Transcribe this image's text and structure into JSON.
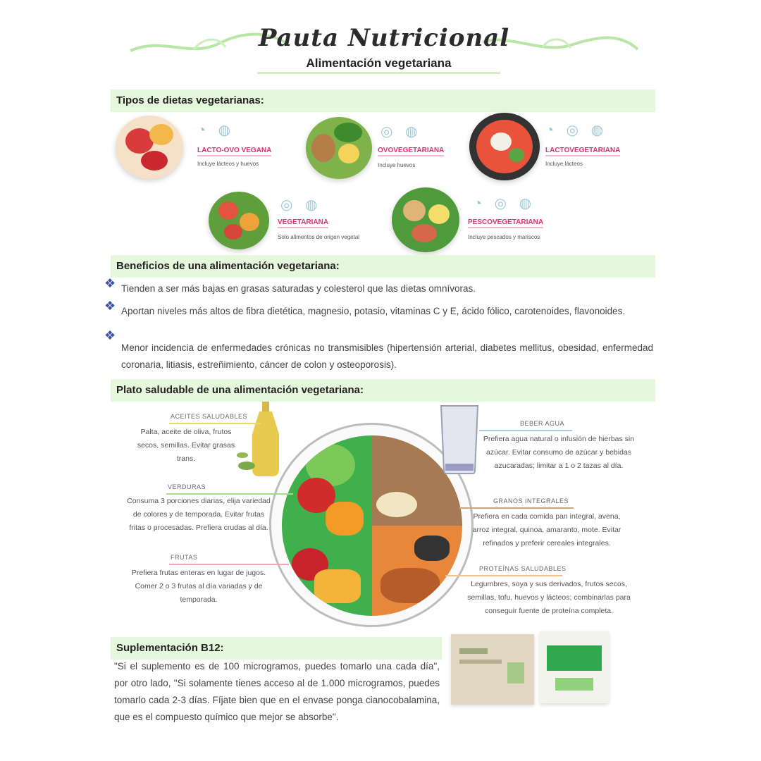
{
  "header": {
    "title": "Pauta Nutricional",
    "subtitle": "Alimentación vegetariana"
  },
  "sections": {
    "types": "Tipos de dietas vegetarianas:",
    "benefits": "Beneficios de una alimentación vegetariana:",
    "plate": "Plato saludable de una alimentación vegetariana:",
    "supplement": "Suplementación B12:"
  },
  "diets": [
    {
      "name": "LACTO-OVO VEGANA",
      "desc": "Incluye lácteos y huevos"
    },
    {
      "name": "OVOVEGETARIANA",
      "desc": "Incluye huevos"
    },
    {
      "name": "LACTOVEGETARIANA",
      "desc": "Incluye lácteos"
    },
    {
      "name": "VEGETARIANA",
      "desc": "Solo alimentos de origen vegetal"
    },
    {
      "name": "PESCOVEGETARIANA",
      "desc": "Incluye pescados y mariscos"
    }
  ],
  "benefits": [
    "Tienden a ser más bajas en grasas saturadas y colesterol que las dietas omnívoras.",
    "Aportan niveles más altos de fibra dietética, magnesio, potasio, vitaminas C y E, ácido fólico, carotenoides, flavonoides.",
    "Menor incidencia de enfermedades crónicas no transmisibles (hipertensión arterial, diabetes mellitus, obesidad, enfermedad coronaria, litiasis, estreñimiento, cáncer de colon y osteoporosis)."
  ],
  "plate": {
    "oils": {
      "label": "ACEITES SALUDABLES",
      "text": "Palta, aceite de oliva, frutos secos, semillas. Evitar grasas trans."
    },
    "water": {
      "label": "BEBER AGUA",
      "text": "Prefiera agua natural o infusión de hierbas sin azúcar. Evitar consumo de azúcar y bebidas azucaradas; limitar a 1 o 2 tazas al día."
    },
    "vegetables": {
      "label": "VERDURAS",
      "text": "Consuma 3 porciones diarias, elija variedad de colores y de temporada. Evitar frutas fritas o procesadas. Prefiera crudas al día."
    },
    "grains": {
      "label": "GRANOS INTEGRALES",
      "text": "Prefiera en cada comida pan integral, avena, arroz integral, quinoa, amaranto, mote. Evitar refinados y preferir cereales integrales."
    },
    "fruits": {
      "label": "FRUTAS",
      "text": "Prefiera frutas enteras en lugar de jugos. Comer 2 o 3 frutas al día variadas y de temporada."
    },
    "proteins": {
      "label": "PROTEÍNAS SALUDABLES",
      "text": "Legumbres, soya y sus derivados, frutos secos, semillas, tofu, huevos y lácteos; combinarlas para conseguir fuente de proteína completa."
    }
  },
  "supplement": {
    "text": "\"Si el suplemento es de 100 microgramos, puedes tomarlo una cada día\", por otro lado, \"Si solamente tienes acceso al de 1.000 microgramos, puedes tomarlo cada 2-3 días. Fíjate bien que en el envase ponga cianocobalamina, que es el compuesto químico que mejor se absorbe\"."
  },
  "colors": {
    "section_bg": "#e6f8dc",
    "accent_pink": "#e0316e",
    "bullet_blue": "#3a4fa8"
  }
}
